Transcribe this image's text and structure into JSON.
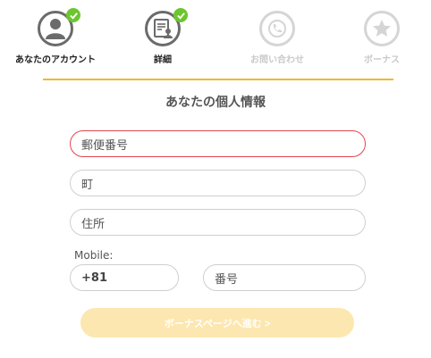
{
  "steps": [
    {
      "label": "あなたのアカウント",
      "icon": "user-icon",
      "status": "done"
    },
    {
      "label": "詳細",
      "icon": "document-user-icon",
      "status": "done"
    },
    {
      "label": "お問い合わせ",
      "icon": "phone-icon",
      "status": "todo"
    },
    {
      "label": "ボーナス",
      "icon": "star-icon",
      "status": "todo"
    }
  ],
  "colors": {
    "accent": "#f0b92b",
    "check": "#6cc62e",
    "error": "#e0474c",
    "button": "#fde7b0"
  },
  "form": {
    "title": "あなたの個人情報",
    "postal_placeholder": "郵便番号",
    "town_placeholder": "町",
    "address_placeholder": "住所",
    "mobile_label": "Mobile:",
    "country_code": "+81",
    "number_placeholder": "番号"
  },
  "next_button": "ボーナスページへ進む >"
}
